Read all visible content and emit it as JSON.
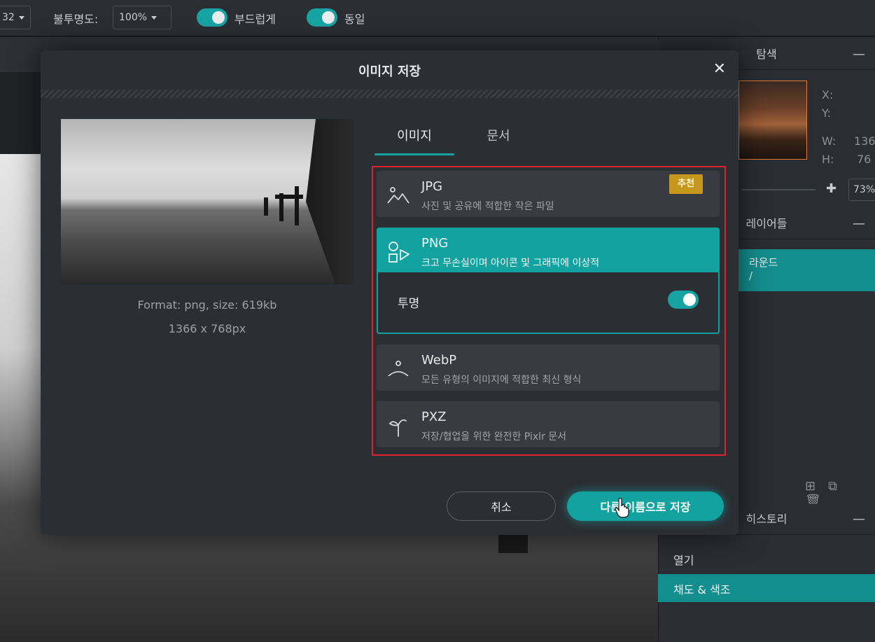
{
  "toolbar": {
    "size_value": "32",
    "opacity_label": "불투명도:",
    "opacity_value": "100%",
    "smooth_label": "부드럽게",
    "same_label": "동일"
  },
  "navigator": {
    "title": "탐색",
    "x_label": "X:",
    "y_label": "Y:",
    "w_label": "W:",
    "w_value": "136",
    "h_label": "H:",
    "h_value": "76",
    "zoom_value": "73%"
  },
  "layers": {
    "title": "레이어들",
    "selected_layer": "라운드",
    "selected_layer_sub": "/"
  },
  "history": {
    "title": "히스토리",
    "items": [
      "열기",
      "채도 & 색조"
    ]
  },
  "dialog": {
    "title": "이미지 저장",
    "close_symbol": "✕",
    "preview_format": "Format: png, size: 619kb",
    "preview_dims": "1366 x 768px",
    "tabs": [
      "이미지",
      "문서"
    ],
    "formats": [
      {
        "name": "JPG",
        "description": "사진 및 공유에 적합한 작은 파일",
        "badge": "추천",
        "icon": "landscape-icon"
      },
      {
        "name": "PNG",
        "description": "크고 무손실이며 아이콘 및 그래픽에 이상적",
        "icon": "shapes-icon"
      },
      {
        "name": "WebP",
        "description": "모든 유형의 이미지에 적합한 최신 형식",
        "icon": "webp-icon"
      },
      {
        "name": "PXZ",
        "description": "저장/협업을 위한 완전한 Pixlr 문서",
        "icon": "pxz-icon"
      }
    ],
    "transparent_label": "투명",
    "transparent_on": true,
    "cancel_label": "취소",
    "save_label": "다른 이름으로 저장"
  },
  "colors": {
    "accent": "#12a2a0",
    "highlight_border": "#e0242f",
    "badge": "#c5971c"
  }
}
